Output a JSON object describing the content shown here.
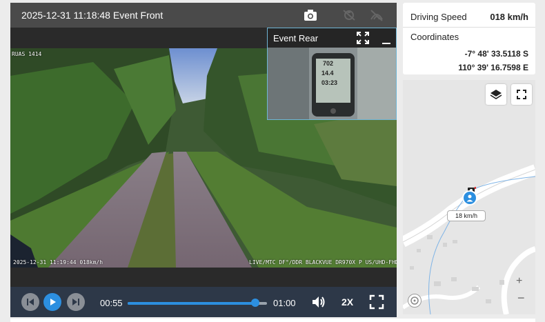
{
  "video": {
    "title": "2025-12-31 11:18:48 Event Front",
    "osd_top": "RUAS 1414",
    "osd_bottom_left": "2025-12-31 11:19:44 018km/h",
    "osd_bottom_right": "LIVE/MTC DF°/DDR BLACKVUE DR970X P US/UHD-FHD",
    "header_icons": [
      "camera-icon",
      "drone-icon",
      "no-signal-icon"
    ]
  },
  "rear": {
    "title": "Event Rear",
    "gps_display": [
      "702",
      "14.4",
      "03:23"
    ],
    "icons": [
      "expand-icon",
      "minimize-icon"
    ]
  },
  "controls": {
    "time_current": "00:55",
    "time_total": "01:00",
    "progress": 0.917,
    "speed_label": "2X",
    "icons": [
      "prev-icon",
      "play-icon",
      "next-icon",
      "volume-icon",
      "fullscreen-icon"
    ]
  },
  "info": {
    "speed_label": "Driving Speed",
    "speed_value": "018 km/h",
    "coords_label": "Coordinates",
    "latitude": "-7° 48' 33.5118 S",
    "longitude": "110° 39' 16.7598 E"
  },
  "map": {
    "speed_tag": "18 km/h",
    "zoom_in": "+",
    "zoom_out": "−",
    "icons": [
      "layers-icon",
      "fullscreen-icon",
      "compass-icon",
      "camera-icon",
      "person-icon"
    ]
  },
  "colors": {
    "accent": "#2c8fe0",
    "control_bar": "#2d3848",
    "header": "#4a4a4a"
  }
}
